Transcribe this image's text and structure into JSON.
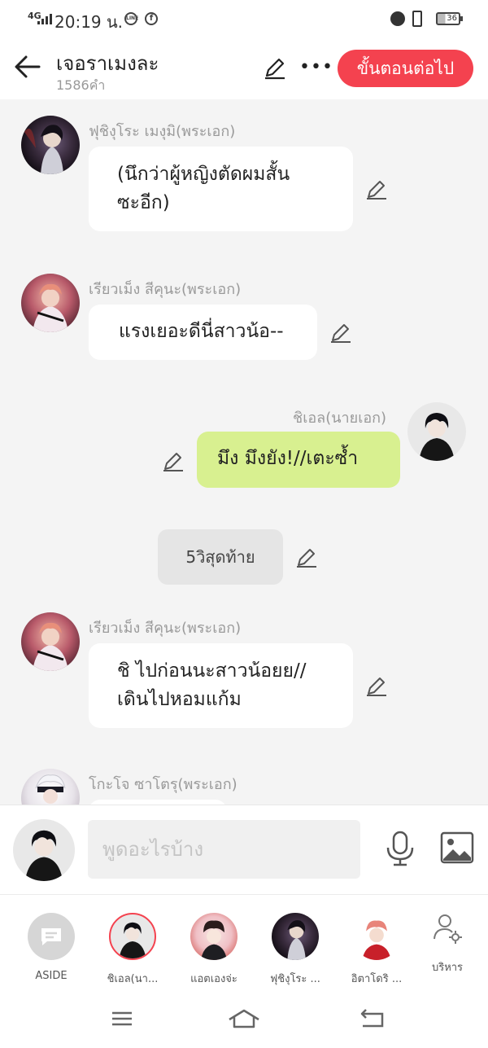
{
  "status_bar": {
    "network": "4G",
    "time": "20:19 น.",
    "battery": "36"
  },
  "header": {
    "title": "เจอราเมงละ",
    "word_count": "1586คำ",
    "next_button": "ขั้นตอนต่อไป"
  },
  "messages": [
    {
      "sender": "ฟุชิงุโระ เมงุมิ(พระเอก)",
      "lines": [
        "(นึกว่าผู้หญิงตัดผมสั้น",
        "ซะอีก)"
      ]
    },
    {
      "sender": "เรียวเม็ง สีคุนะ(พระเอก)",
      "lines": [
        "แรงเยอะดีนี่สาวน้อ--"
      ]
    },
    {
      "sender": "ชิเอล(นายเอก)",
      "lines": [
        "มึง มึงยัง!//เตะซ้ำ"
      ]
    },
    {
      "aside": "5วิสุดท้าย"
    },
    {
      "sender": "เรียวเม็ง สีคุนะ(พระเอก)",
      "lines": [
        "ชิ ไปก่อนนะสาวน้อยย//",
        "เดินไปหอมแก้ม"
      ]
    },
    {
      "sender": "โกะโจ ซาโตรุ(พระเอก)",
      "lines": [
        ""
      ]
    }
  ],
  "input": {
    "placeholder": "พูดอะไรบ้าง"
  },
  "characters": [
    {
      "label": "ASIDE"
    },
    {
      "label": "ชิเอล(นา..."
    },
    {
      "label": "แอตเองจ่ะ"
    },
    {
      "label": "ฟุชิงุโระ ..."
    },
    {
      "label": "อิตาโดริ ..."
    }
  ],
  "manage_label": "บริหาร",
  "colors": {
    "accent": "#f4424f",
    "my_bubble": "#d8f090",
    "background": "#f4f4f4"
  }
}
